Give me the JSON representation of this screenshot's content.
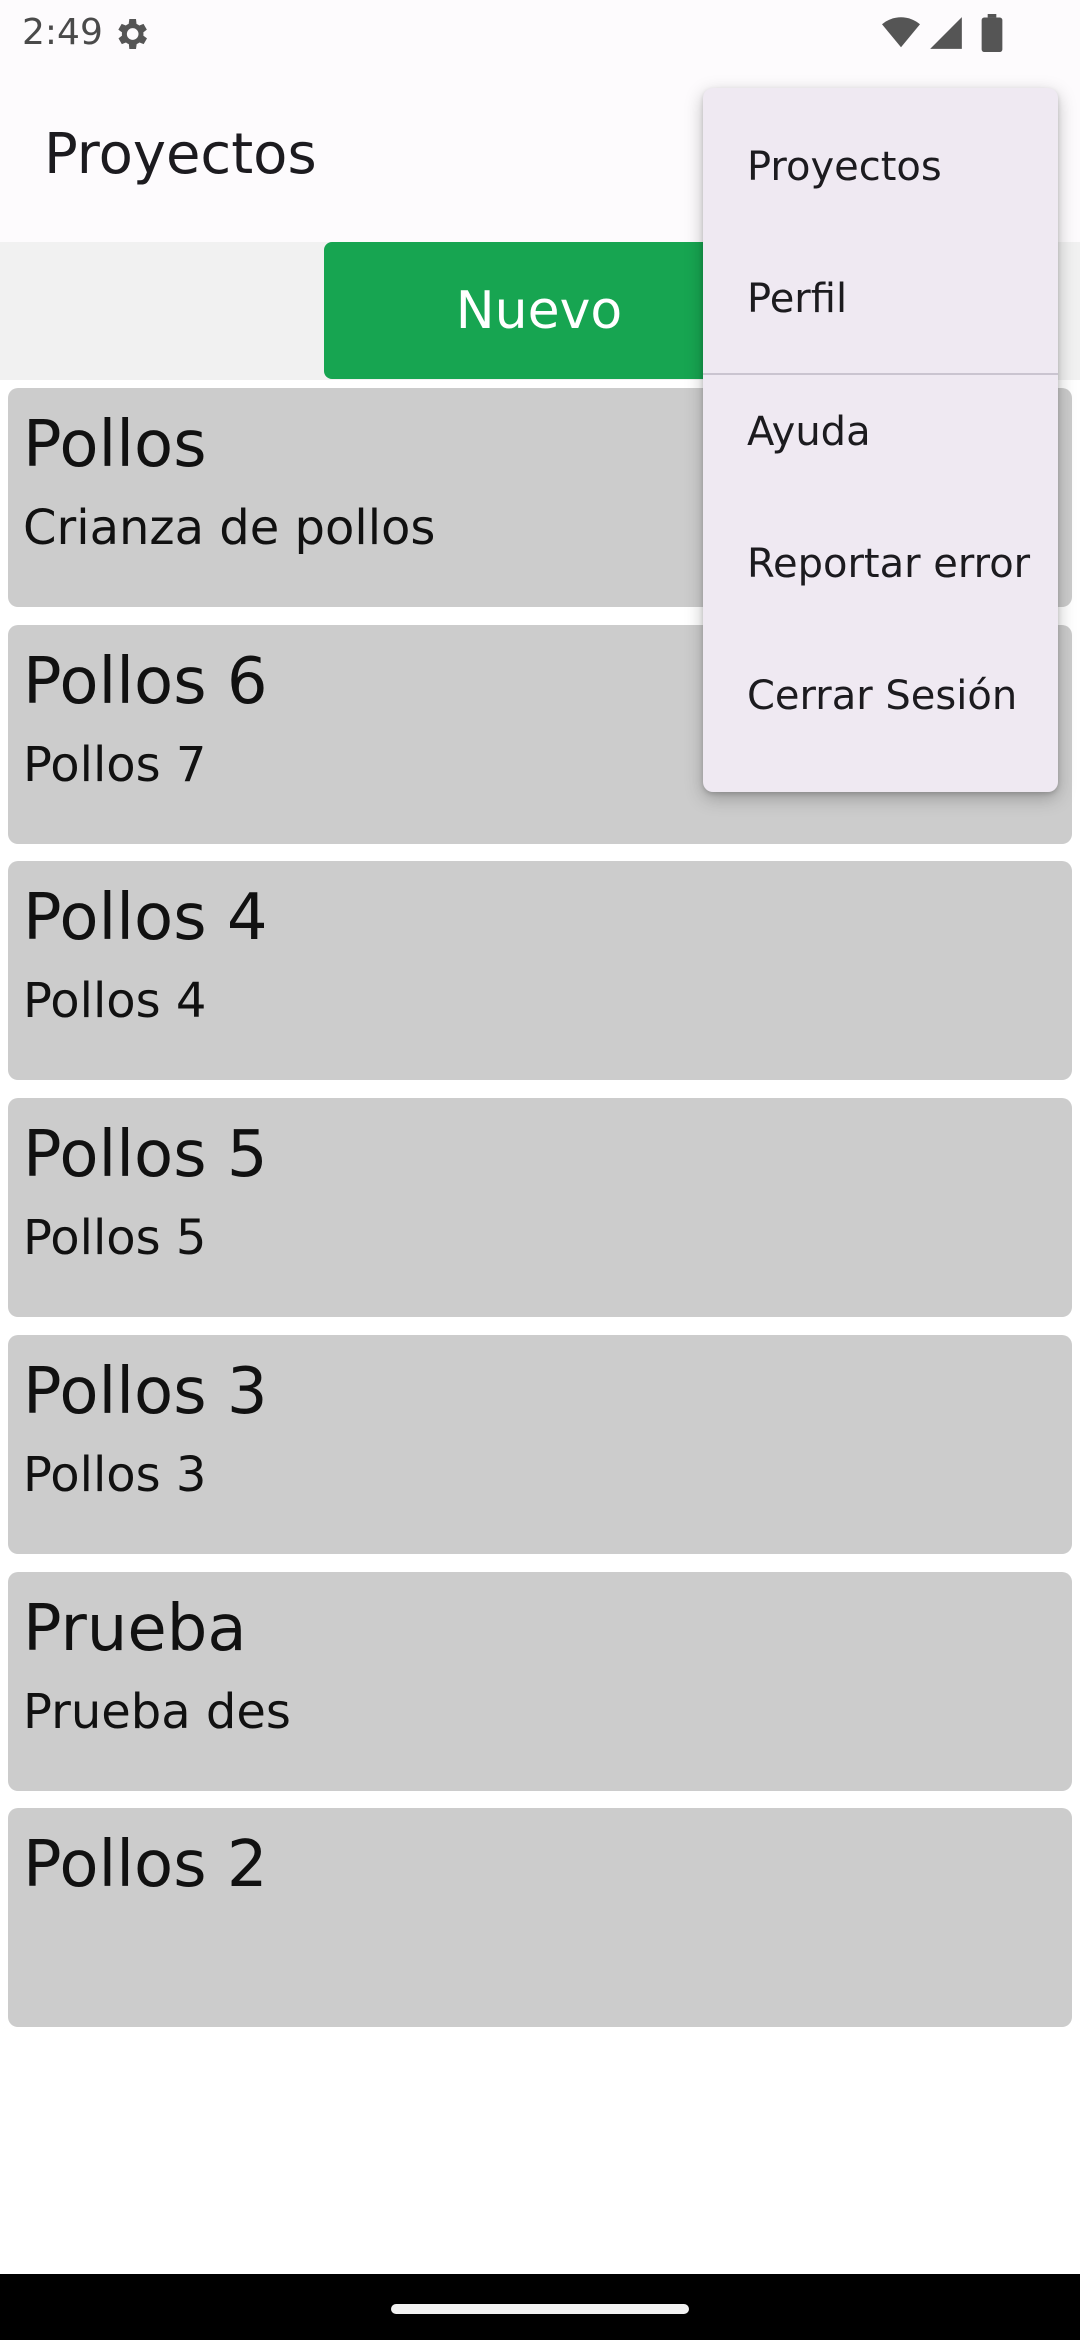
{
  "status_bar": {
    "time": "2:49",
    "icons": [
      "settings-gear-icon",
      "wifi-icon",
      "cellular-signal-icon",
      "battery-icon"
    ]
  },
  "app_bar": {
    "title": "Proyectos"
  },
  "toolbar": {
    "new_label": "Nuevo",
    "new_color": "#17a551"
  },
  "projects": [
    {
      "name": "Pollos",
      "description": "Crianza de pollos"
    },
    {
      "name": "Pollos 6",
      "description": "Pollos 7"
    },
    {
      "name": "Pollos 4",
      "description": "Pollos 4"
    },
    {
      "name": "Pollos 5",
      "description": "Pollos 5"
    },
    {
      "name": "Pollos 3",
      "description": "Pollos 3"
    },
    {
      "name": "Prueba",
      "description": "Prueba des"
    },
    {
      "name": "Pollos 2",
      "description": ""
    }
  ],
  "overflow_menu": {
    "items": [
      {
        "label": "Proyectos"
      },
      {
        "label": "Perfil"
      },
      {
        "label": "Ayuda"
      },
      {
        "label": "Reportar error"
      },
      {
        "label": "Cerrar Sesión"
      }
    ]
  }
}
